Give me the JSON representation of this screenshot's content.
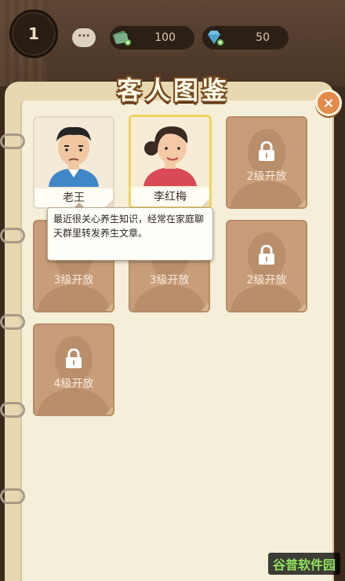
{
  "hud": {
    "level": "1",
    "chat_label": "···",
    "currency": [
      {
        "icon": "cash-icon",
        "value": "100"
      },
      {
        "icon": "diamond-icon",
        "value": "50"
      }
    ]
  },
  "panel": {
    "title": "客人图鉴",
    "close_label": "×"
  },
  "guests": [
    {
      "name": "老王",
      "status": "unlocked"
    },
    {
      "name": "李红梅",
      "status": "unlocked",
      "selected": true
    },
    {
      "status": "locked",
      "unlock_text": "2级开放"
    },
    {
      "status": "locked",
      "unlock_text": "3级开放"
    },
    {
      "status": "locked",
      "unlock_text": "3级开放"
    },
    {
      "status": "locked",
      "unlock_text": "2级开放"
    },
    {
      "status": "locked",
      "unlock_text": "4级开放"
    }
  ],
  "tooltip": {
    "text": "最近很关心养生知识，经常在家庭聊天群里转发养生文章。"
  },
  "watermark": "谷普软件园"
}
